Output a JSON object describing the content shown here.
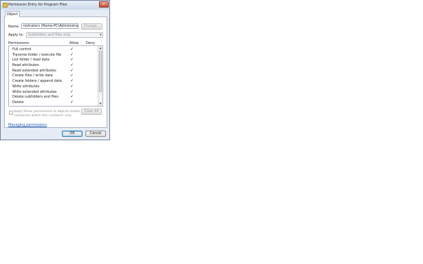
{
  "window": {
    "title": "Permission Entry for Program Files",
    "close_glyph": "x"
  },
  "tab": {
    "label": "Object"
  },
  "name_field": {
    "label": "Name:",
    "value": "nistrators (Home-PC\\Administrators)"
  },
  "change_button": {
    "label": "Change..."
  },
  "apply_to": {
    "label": "Apply to:",
    "value": "Subfolders and files only"
  },
  "permissions": {
    "label": "Permissions:",
    "allow_header": "Allow",
    "deny_header": "Deny",
    "items": [
      {
        "name": "Full control",
        "allow": "✓"
      },
      {
        "name": "Traverse folder / execute file",
        "allow": "✓"
      },
      {
        "name": "List folder / read data",
        "allow": "✓"
      },
      {
        "name": "Read attributes",
        "allow": "✓"
      },
      {
        "name": "Read extended attributes",
        "allow": "✓"
      },
      {
        "name": "Create files / write data",
        "allow": "✓"
      },
      {
        "name": "Create folders / append data",
        "allow": "✓"
      },
      {
        "name": "Write attributes",
        "allow": "✓"
      },
      {
        "name": "Write extended attributes",
        "allow": "✓"
      },
      {
        "name": "Delete subfolders and files",
        "allow": "✓"
      },
      {
        "name": "Delete",
        "allow": "✓"
      }
    ]
  },
  "apply_checkbox": {
    "line1": "Apply these permissions to objects and/or",
    "line2": "containers within this container only"
  },
  "clear_all_button": {
    "label": "Clear All"
  },
  "manage_link": {
    "label": "Managing permissions"
  },
  "ok_button": {
    "label": "OK"
  },
  "cancel_button": {
    "label": "Cancel"
  }
}
